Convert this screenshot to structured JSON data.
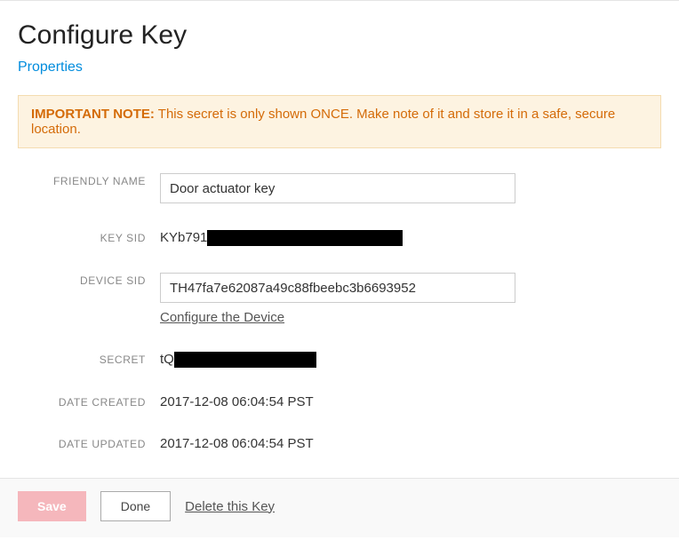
{
  "header": {
    "title": "Configure Key",
    "subtitle": "Properties"
  },
  "notice": {
    "bold": "IMPORTANT NOTE:",
    "text": "This secret is only shown ONCE. Make note of it and store it in a safe, secure location."
  },
  "fields": {
    "friendly_name": {
      "label": "FRIENDLY NAME",
      "value": "Door actuator key"
    },
    "key_sid": {
      "label": "KEY SID",
      "prefix": "KYb791"
    },
    "device_sid": {
      "label": "DEVICE SID",
      "value": "TH47fa7e62087a49c88fbeebc3b6693952",
      "link": "Configure the Device"
    },
    "secret": {
      "label": "SECRET",
      "prefix": "tQ"
    },
    "date_created": {
      "label": "DATE CREATED",
      "value": "2017-12-08 06:04:54 PST"
    },
    "date_updated": {
      "label": "DATE UPDATED",
      "value": "2017-12-08 06:04:54 PST"
    }
  },
  "footer": {
    "save": "Save",
    "done": "Done",
    "delete": "Delete this Key"
  }
}
